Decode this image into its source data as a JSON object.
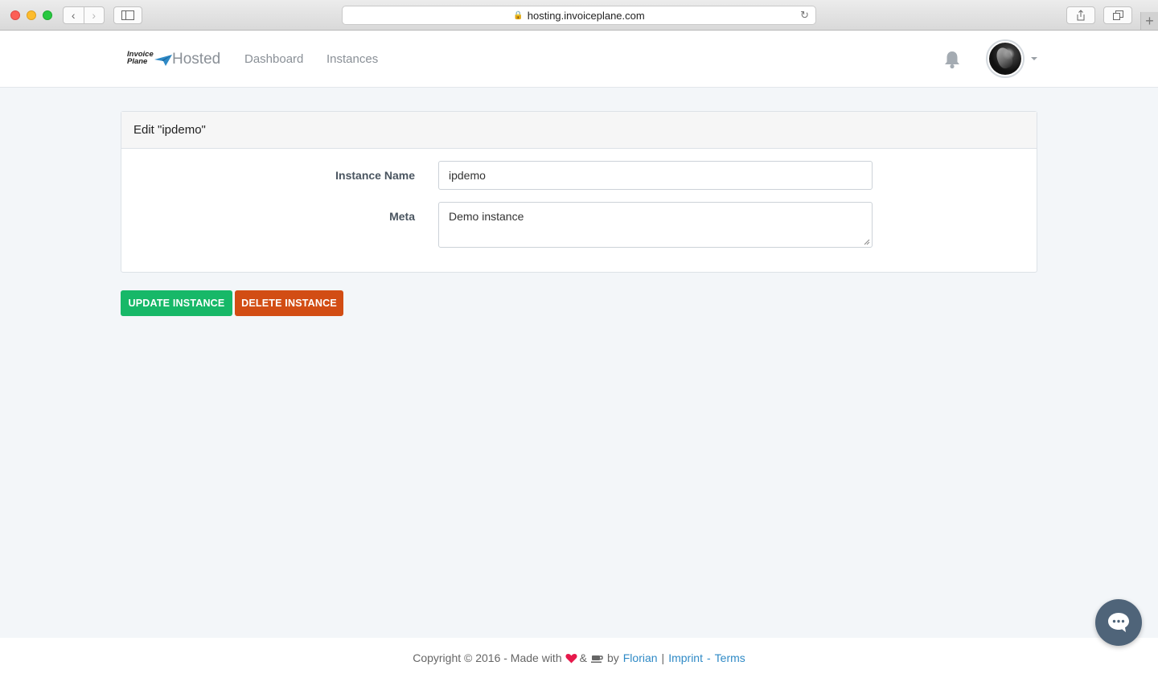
{
  "browser": {
    "url": "hosting.invoiceplane.com"
  },
  "header": {
    "logo_line1": "Invoice",
    "logo_line2": "Plane",
    "product": "Hosted",
    "nav": [
      "Dashboard",
      "Instances"
    ]
  },
  "card": {
    "title": "Edit \"ipdemo\"",
    "fields": {
      "name_label": "Instance Name",
      "name_value": "ipdemo",
      "meta_label": "Meta",
      "meta_value": "Demo instance"
    }
  },
  "actions": {
    "update_label": "UPDATE INSTANCE",
    "delete_label": "DELETE INSTANCE"
  },
  "footer": {
    "copyright": "Copyright © 2016 - Made with",
    "amp": "&",
    "by": "by",
    "author": "Florian",
    "imprint": "Imprint",
    "dash": "-",
    "terms": "Terms",
    "pipe": "|"
  },
  "colors": {
    "update": "#17b868",
    "delete": "#d24d14",
    "link": "#2f8ac6",
    "heart": "#e6194b"
  }
}
